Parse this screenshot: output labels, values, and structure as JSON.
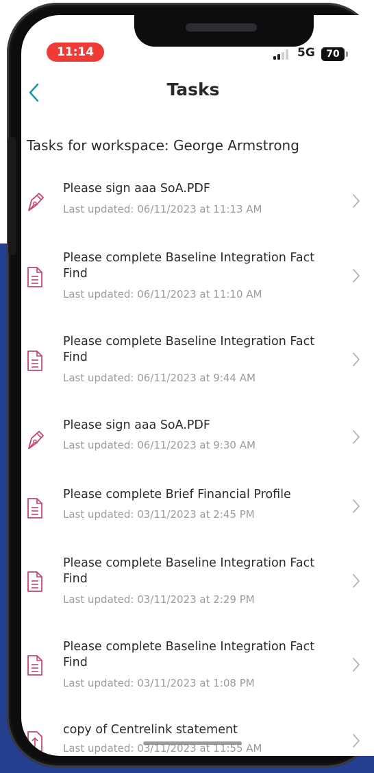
{
  "status_bar": {
    "time": "11:14",
    "network": "5G",
    "battery": "70"
  },
  "header": {
    "title": "Tasks",
    "back_icon": "chevron-left-icon"
  },
  "section_title": "Tasks for workspace: George Armstrong",
  "colors": {
    "accent": "#1a9ba0",
    "icon_pink": "#c2476b",
    "time_pill": "#ef3b36",
    "background_band": "#243f8f"
  },
  "tasks": [
    {
      "icon": "pen-icon",
      "title": "Please sign aaa SoA.PDF",
      "updated": "Last updated: 06/11/2023 at 11:13 AM"
    },
    {
      "icon": "document-icon",
      "title": "Please complete Baseline Integration Fact Find",
      "updated": "Last updated: 06/11/2023 at 11:10 AM"
    },
    {
      "icon": "document-icon",
      "title": "Please complete Baseline Integration Fact Find",
      "updated": "Last updated: 06/11/2023 at 9:44 AM"
    },
    {
      "icon": "pen-icon",
      "title": "Please sign aaa SoA.PDF",
      "updated": "Last updated: 06/11/2023 at 9:30 AM"
    },
    {
      "icon": "document-icon",
      "title": "Please complete Brief Financial Profile",
      "updated": "Last updated: 03/11/2023 at 2:45 PM"
    },
    {
      "icon": "document-icon",
      "title": "Please complete Baseline Integration Fact Find",
      "updated": "Last updated: 03/11/2023 at 2:29 PM"
    },
    {
      "icon": "document-icon",
      "title": "Please complete Baseline Integration Fact Find",
      "updated": "Last updated: 03/11/2023 at 1:08 PM"
    },
    {
      "icon": "upload-document-icon",
      "title": "copy of Centrelink statement",
      "updated": "Last updated: 03/11/2023 at 11:55 AM"
    }
  ]
}
